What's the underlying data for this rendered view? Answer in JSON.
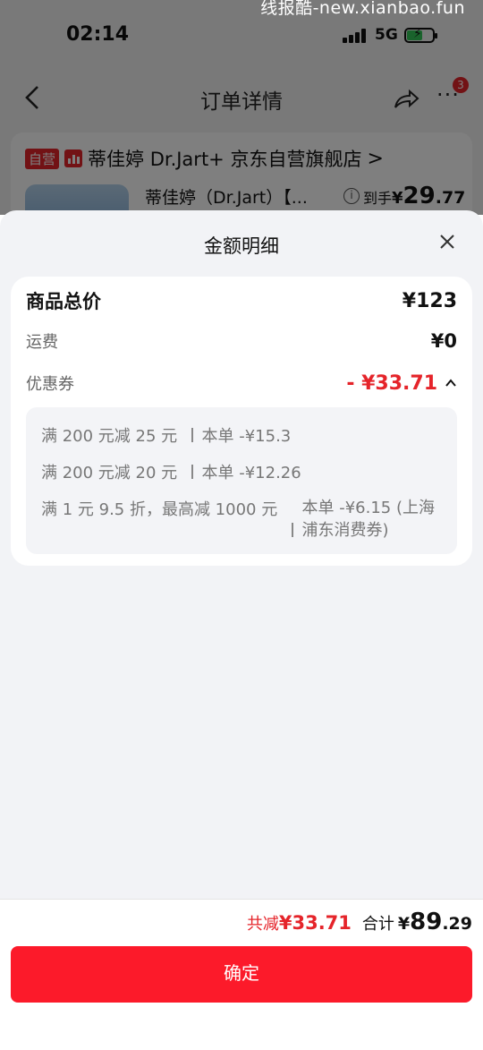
{
  "watermark": "线报酷-new.xianbao.fun",
  "status_bar": {
    "time": "02:14",
    "network": "5G"
  },
  "navbar": {
    "title": "订单详情",
    "badge_count": "3",
    "more_label": "···"
  },
  "store": {
    "self_tag": "自营",
    "name": "蒂佳婷 Dr.Jart+ 京东自营旗舰店",
    "arrow": ">",
    "product_name": "蒂佳婷（Dr.Jart）【...",
    "info_glyph": "i",
    "price_label": "到手",
    "price_currency": "¥",
    "price_int": "29",
    "price_dec": ".77"
  },
  "sheet": {
    "title": "金额明细",
    "total_label": "商品总价",
    "total_value": "¥123",
    "shipping_label": "运费",
    "shipping_value": "¥0",
    "coupon_label": "优惠券",
    "coupon_value": "- ¥33.71",
    "coupons": [
      {
        "condition": "满 200 元减 25 元",
        "amount": "本单 -¥15.3"
      },
      {
        "condition": "满 200 元减 20 元",
        "amount": "本单 -¥12.26"
      },
      {
        "condition": "满 1 元 9.5 折，最高减 1000 元",
        "amount": "本单 -¥6.15 (上海浦东消费券)"
      }
    ]
  },
  "footer": {
    "save_label": "共减",
    "save_value": "¥33.71",
    "total_label": "合计",
    "total_currency": "¥",
    "total_int": "89",
    "total_dec": ".29",
    "confirm_label": "确定"
  },
  "colors": {
    "accent_red": "#e5242a",
    "button_red": "#fc1a2a"
  }
}
